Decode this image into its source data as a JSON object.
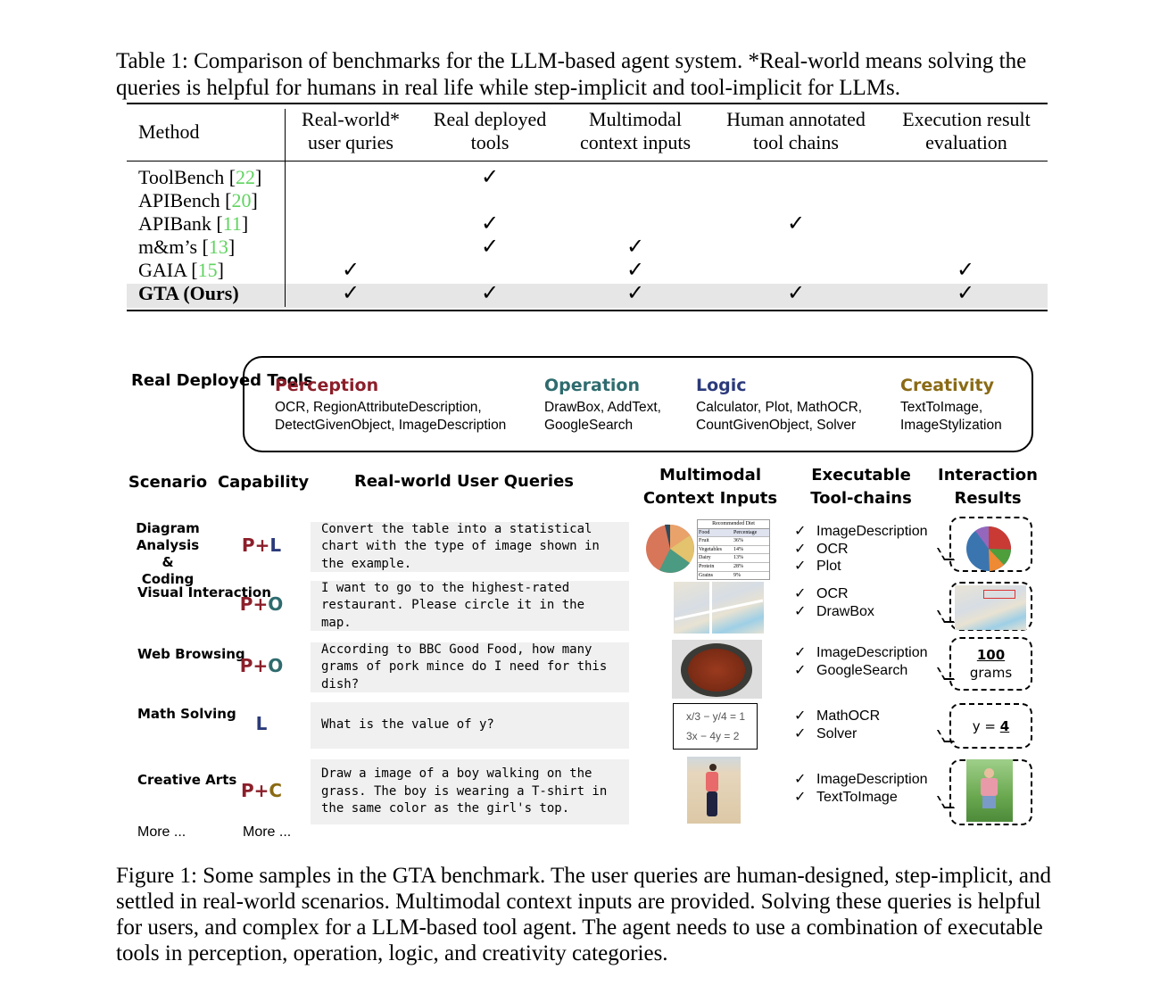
{
  "table": {
    "caption": "Table 1: Comparison of benchmarks for the LLM-based agent system. *Real-world means solving the queries is helpful for humans in real life while step-implicit and tool-implicit for LLMs.",
    "headers": [
      "Method",
      "Real-world* user quries",
      "Real deployed tools",
      "Multimodal context inputs",
      "Human annotated tool chains",
      "Execution result evaluation"
    ],
    "check_mark": "✓",
    "rows": [
      {
        "name": "ToolBench",
        "cite": "22",
        "checks": [
          false,
          true,
          false,
          false,
          false
        ]
      },
      {
        "name": "APIBench",
        "cite": "20",
        "checks": [
          false,
          false,
          false,
          false,
          false
        ]
      },
      {
        "name": "APIBank",
        "cite": "11",
        "checks": [
          false,
          true,
          false,
          true,
          false
        ]
      },
      {
        "name": "m&m’s",
        "cite": "13",
        "checks": [
          false,
          true,
          true,
          false,
          false
        ]
      },
      {
        "name": "GAIA",
        "cite": "15",
        "checks": [
          true,
          false,
          true,
          false,
          true
        ]
      },
      {
        "name": "GTA (Ours)",
        "cite": "",
        "checks": [
          true,
          true,
          true,
          true,
          true
        ],
        "highlight": true
      }
    ],
    "citation_color": "#5fd35f"
  },
  "figure": {
    "tools_label": "Real Deployed Tools",
    "categories": [
      {
        "name": "Perception",
        "color": "#8b1f2a",
        "tools": "OCR, RegionAttributeDescription, DetectGivenObject, ImageDescription"
      },
      {
        "name": "Operation",
        "color": "#2e6b6e",
        "tools": "DrawBox, AddText, GoogleSearch"
      },
      {
        "name": "Logic",
        "color": "#2b3a7a",
        "tools": "Calculator, Plot, MathOCR, CountGivenObject, Solver"
      },
      {
        "name": "Creativity",
        "color": "#8a6a14",
        "tools": "TextToImage, ImageStylization"
      }
    ],
    "column_headers": {
      "scenario": "Scenario",
      "capability": "Capability",
      "queries": "Real-world User Queries",
      "inputs": "Multimodal Context Inputs",
      "toolchains": "Executable Tool-chains",
      "results": "Interaction Results"
    },
    "samples": [
      {
        "scenario": "Diagram Analysis & Coding",
        "cap": [
          "P",
          "L"
        ],
        "query": "Convert the table into a statistical chart with the type of image shown in the example.",
        "tools": [
          "ImageDescription",
          "OCR",
          "Plot"
        ],
        "result_type": "pie-chart"
      },
      {
        "scenario": "Visual Interaction",
        "cap": [
          "P",
          "O"
        ],
        "query": "I want to go to the highest-rated restaurant. Please circle it in the map.",
        "tools": [
          "OCR",
          "DrawBox"
        ],
        "result_type": "map"
      },
      {
        "scenario": "Web Browsing",
        "cap": [
          "P",
          "O"
        ],
        "query": "According to BBC Good Food, how many grams of pork mince do I need for this dish?",
        "tools": [
          "ImageDescription",
          "GoogleSearch"
        ],
        "result": {
          "value": "100",
          "unit": "grams"
        }
      },
      {
        "scenario": "Math Solving",
        "cap": [
          "L"
        ],
        "query": "What is the value of y?",
        "tools": [
          "MathOCR",
          "Solver"
        ],
        "result": {
          "prefix": "y = ",
          "value": "4"
        }
      },
      {
        "scenario": "Creative Arts",
        "cap": [
          "P",
          "C"
        ],
        "query": "Draw a image of a boy walking on the grass. The boy is wearing a T-shirt in the same color as the girl's top.",
        "tools": [
          "ImageDescription",
          "TextToImage"
        ],
        "result_type": "generated-image"
      }
    ],
    "diet_table": {
      "title": "Recommended Diet",
      "headers": [
        "Food",
        "Percentage"
      ],
      "rows": [
        [
          "Fruit",
          "36%"
        ],
        [
          "Vegetables",
          "14%"
        ],
        [
          "Dairy",
          "13%"
        ],
        [
          "Protein",
          "28%"
        ],
        [
          "Grains",
          "9%"
        ]
      ]
    },
    "math": {
      "eq1": "x/3 − y/4 = 1",
      "eq2": "3x − 4y = 2"
    },
    "more_scenario": "More ...",
    "more_capability": "More ...",
    "caption": "Figure 1: Some samples in the GTA benchmark. The user queries are human-designed, step-implicit, and settled in real-world scenarios. Multimodal context inputs are provided. Solving these queries is helpful for users, and complex for a LLM-based tool agent. The agent needs to use a combination of executable tools in perception, operation, logic, and creativity categories."
  }
}
